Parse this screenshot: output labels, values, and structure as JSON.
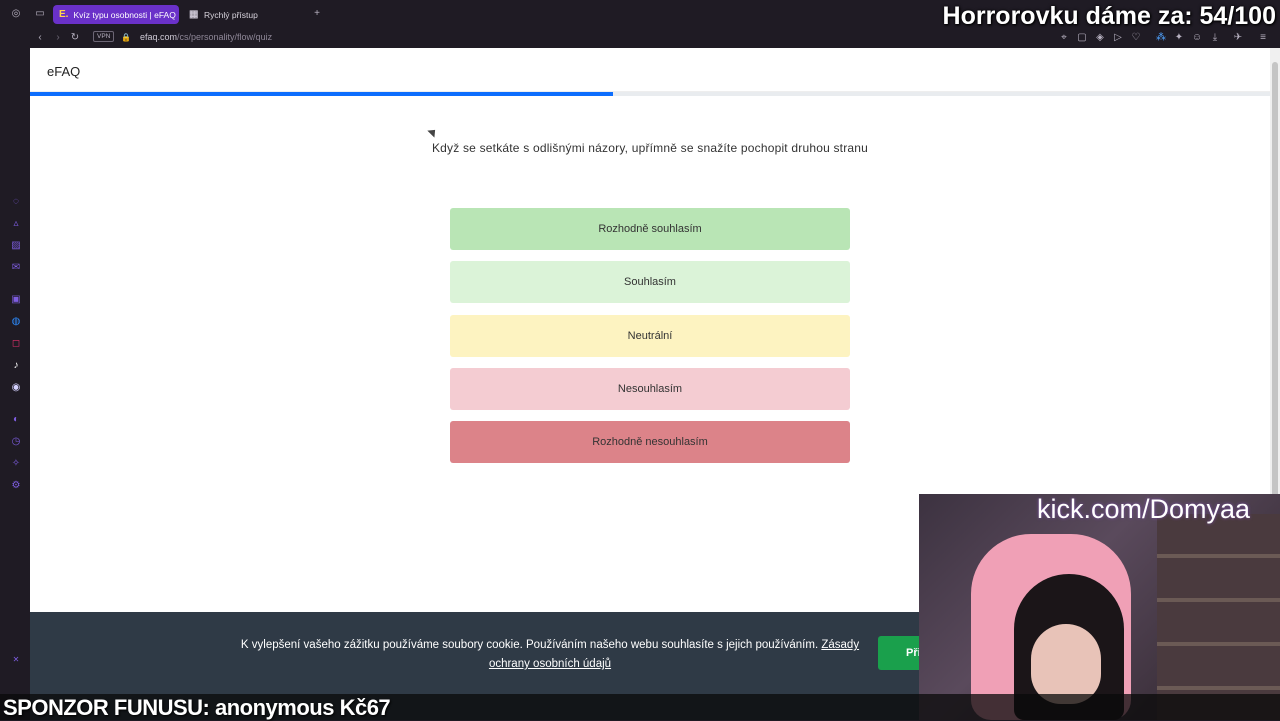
{
  "browser": {
    "tabs": [
      {
        "label": "Kvíz typu osobnosti | eFAQ",
        "favicon": "E.",
        "active": true
      },
      {
        "label": "Rychlý přístup",
        "favicon": "grid-icon",
        "active": false
      }
    ],
    "new_tab": "+",
    "vpn_label": "VPN",
    "url_host": "efaq.com",
    "url_path": "/cs/personality/flow/quiz",
    "accent": "#6a31c9"
  },
  "site": {
    "brand": "eFAQ",
    "progress_fraction": 0.47,
    "progress_color": "#0d6efd"
  },
  "quiz": {
    "question": "Když se setkáte s odlišnými názory, upřímně se snažíte pochopit druhou stranu",
    "answers": [
      {
        "label": "Rozhodně souhlasím",
        "color": "#b9e5b5"
      },
      {
        "label": "Souhlasím",
        "color": "#dbf3d8"
      },
      {
        "label": "Neutrální",
        "color": "#fdf3c1"
      },
      {
        "label": "Nesouhlasím",
        "color": "#f4ccd2"
      },
      {
        "label": "Rozhodně nesouhlasím",
        "color": "#dc8389"
      }
    ]
  },
  "cookie": {
    "text": "K vylepšení vašeho zážitku používáme soubory cookie. Používáním našeho webu souhlasíte s jejich používáním.",
    "link": "Zásady ochrany osobních údajů",
    "button": "Při"
  },
  "stream": {
    "top_overlay": "Horrorovku dáme za: 54/100",
    "cam_label": "kick.com/Domyaa",
    "ticker": "SPONZOR FUNUSU: anonymous Kč67"
  }
}
